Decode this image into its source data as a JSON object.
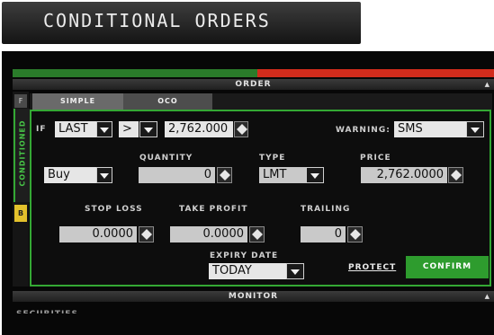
{
  "banner": {
    "title": "CONDITIONAL ORDERS"
  },
  "order_header": {
    "label": "ORDER",
    "arrow": "▲"
  },
  "side_tabs": {
    "f": "F",
    "conditioned": "CONDITIONED",
    "b": "B"
  },
  "tabs": [
    {
      "label": "SIMPLE"
    },
    {
      "label": "OCO"
    }
  ],
  "condition": {
    "if_label": "IF",
    "field_value": "LAST",
    "operator_value": ">",
    "price_value": "2,762.000",
    "warning_label": "WARNING:",
    "warning_value": "SMS"
  },
  "order": {
    "side_value": "Buy",
    "quantity_label": "QUANTITY",
    "quantity_value": "0",
    "type_label": "TYPE",
    "type_value": "LMT",
    "price_label": "PRICE",
    "price_value": "2,762.0000"
  },
  "risk": {
    "stop_loss_label": "STOP LOSS",
    "stop_loss_value": "0.0000",
    "take_profit_label": "TAKE PROFIT",
    "take_profit_value": "0.0000",
    "trailing_label": "TRAILING",
    "trailing_value": "0"
  },
  "expiry": {
    "label": "EXPIRY DATE",
    "value": "TODAY"
  },
  "actions": {
    "protect_label": "PROTECT",
    "confirm_label": "CONFIRM"
  },
  "monitor_header": {
    "label": "MONITOR",
    "arrow": "▲"
  },
  "securities_label": "SECURITIES",
  "colors": {
    "accent_green": "#34a834",
    "confirm_green": "#2e9c2e",
    "bar_red": "#d22c1c",
    "side_b_yellow": "#e3c12c"
  }
}
